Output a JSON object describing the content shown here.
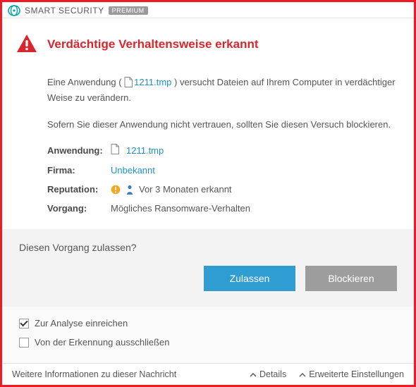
{
  "brand": {
    "name_bold": "SMART",
    "name_light": "SECURITY",
    "badge": "PREMIUM"
  },
  "alert": {
    "title": "Verdächtige Verhaltensweise erkannt",
    "para1_pre": "Eine Anwendung ( ",
    "para1_file": "1211.tmp",
    "para1_post": " ) versucht Dateien auf Ihrem Computer in verdächtiger Weise zu verändern.",
    "para2": "Sofern Sie dieser Anwendung nicht vertrauen, sollten Sie diesen Versuch blockieren."
  },
  "fields": {
    "app_label": "Anwendung:",
    "app_value": "1211.tmp",
    "company_label": "Firma:",
    "company_value": "Unbekannt",
    "reputation_label": "Reputation:",
    "reputation_value": "Vor 3 Monaten erkannt",
    "process_label": "Vorgang:",
    "process_value": "Mögliches Ransomware-Verhalten"
  },
  "action": {
    "question": "Diesen Vorgang zulassen?",
    "allow": "Zulassen",
    "block": "Blockieren"
  },
  "checks": {
    "submit": "Zur Analyse einreichen",
    "exclude": "Von der Erkennung ausschließen"
  },
  "footer": {
    "more_info": "Weitere Informationen zu dieser Nachricht",
    "details": "Details",
    "advanced": "Erweiterte Einstellungen"
  }
}
